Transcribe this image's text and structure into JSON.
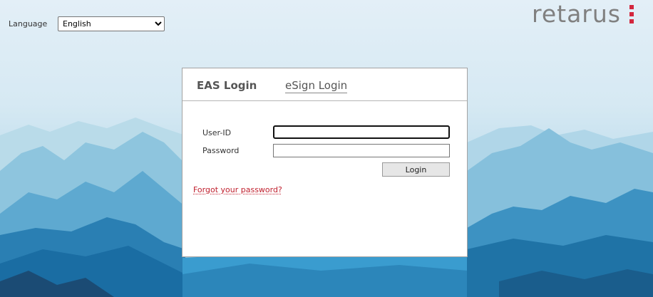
{
  "header": {
    "language_label": "Language",
    "language_selected": "English",
    "brand": "retarus"
  },
  "tabs": [
    {
      "label": "EAS Login",
      "active": true
    },
    {
      "label": "eSign Login",
      "active": false
    }
  ],
  "form": {
    "user_label": "User-ID",
    "user_value": "",
    "password_label": "Password",
    "password_value": "",
    "login_label": "Login",
    "forgot_label": "Forgot your password?"
  },
  "colors": {
    "brand_gray": "#808080",
    "brand_red": "#d3273e",
    "link_red": "#c0202e"
  }
}
